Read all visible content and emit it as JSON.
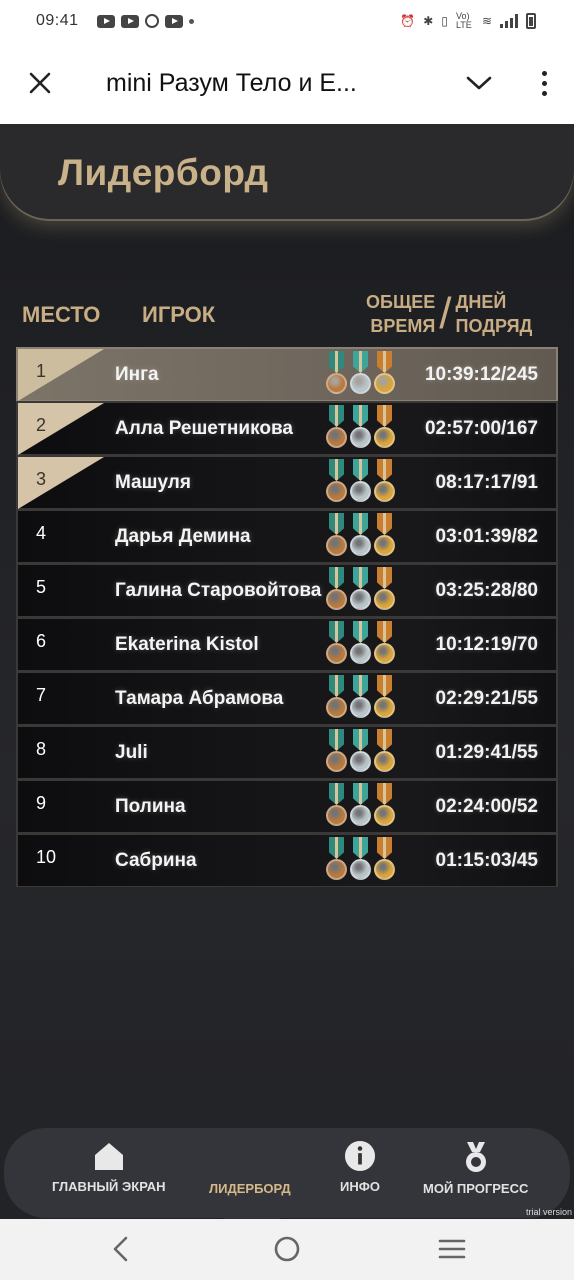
{
  "status_bar": {
    "time": "09:41",
    "network": "Vo) LTE"
  },
  "app_bar": {
    "title": "mini Разум Тело и Е...",
    "close_icon": "close-icon",
    "expand_icon": "chevron-down-icon",
    "menu_icon": "more-vert-icon"
  },
  "page": {
    "title": "Лидерборд"
  },
  "columns": {
    "rank": "МЕСТО",
    "player": "ИГРОК",
    "time_line1": "ОБЩЕЕ",
    "time_line2": "ВРЕМЯ",
    "days_line1": "ДНЕЙ",
    "days_line2": "ПОДРЯД"
  },
  "leaderboard": [
    {
      "rank": "1",
      "name": "Инга",
      "score": "10:39:12/245"
    },
    {
      "rank": "2",
      "name": "Алла Решетникова",
      "score": "02:57:00/167"
    },
    {
      "rank": "3",
      "name": "Машуля",
      "score": "08:17:17/91"
    },
    {
      "rank": "4",
      "name": "Дарья Демина",
      "score": "03:01:39/82"
    },
    {
      "rank": "5",
      "name": "Галина Старовойтова",
      "score": "03:25:28/80"
    },
    {
      "rank": "6",
      "name": "Ekaterina Kistol",
      "score": "10:12:19/70"
    },
    {
      "rank": "7",
      "name": "Тамара Абрамова",
      "score": "02:29:21/55"
    },
    {
      "rank": "8",
      "name": "Juli",
      "score": "01:29:41/55"
    },
    {
      "rank": "9",
      "name": "Полина",
      "score": "02:24:00/52"
    },
    {
      "rank": "10",
      "name": "Сабрина",
      "score": "01:15:03/45"
    }
  ],
  "medal_colors": {
    "bronze": "#b87a3e",
    "silver": "#b9c4c9",
    "gold": "#d9a43a"
  },
  "bottom_nav": {
    "home": "ГЛАВНЫЙ ЭКРАН",
    "leaderboard": "ЛИДЕРБОРД",
    "info": "ИНФО",
    "progress": "МОЙ ПРОГРЕСС"
  },
  "watermark": "trial version"
}
